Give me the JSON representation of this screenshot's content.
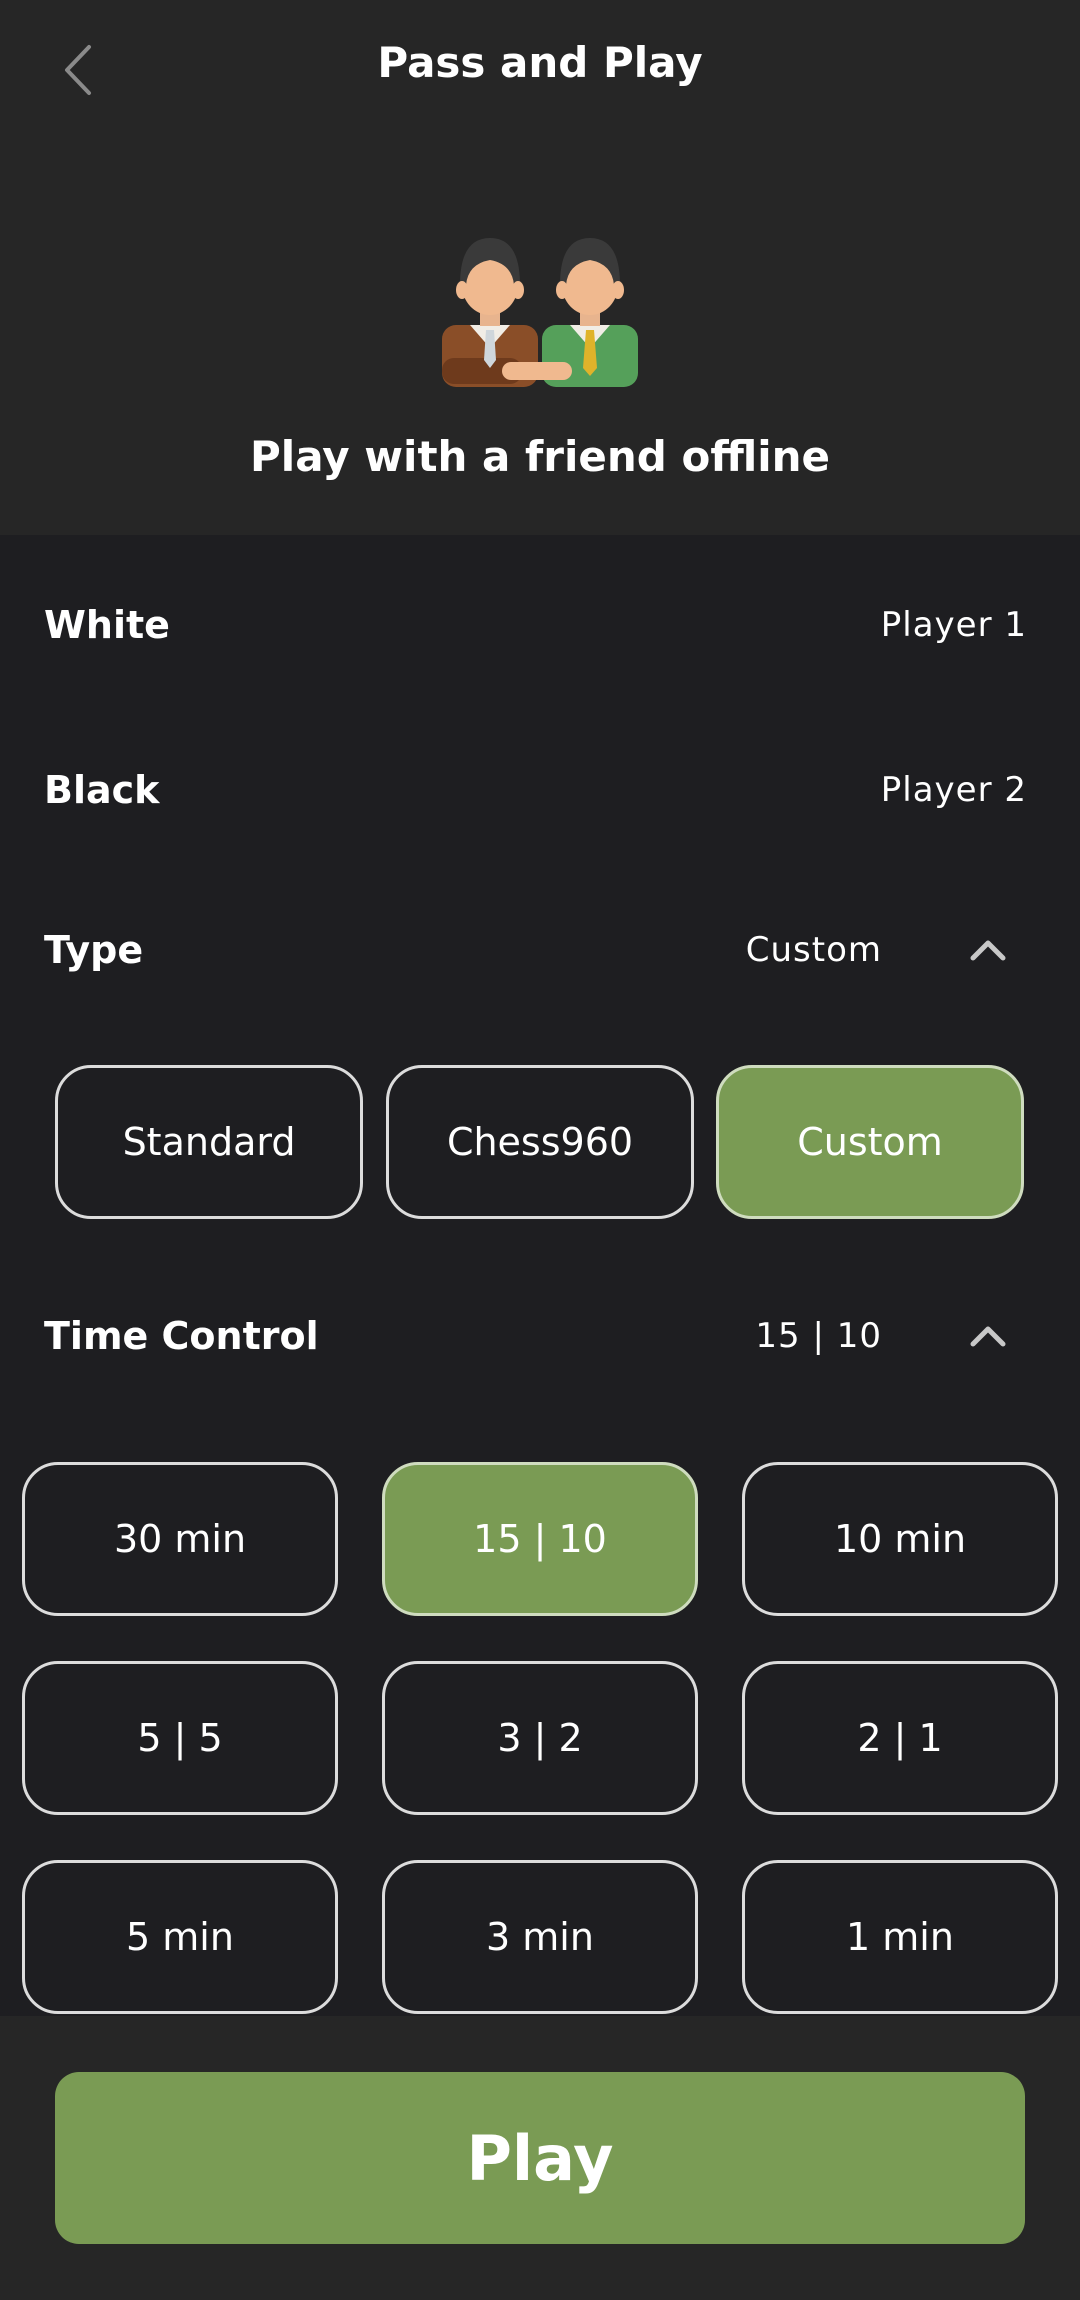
{
  "header": {
    "title": "Pass and Play",
    "back_icon": "chevron-left-icon",
    "hero_icon": "two-players-icon",
    "subtitle": "Play with a friend offline"
  },
  "players": {
    "white_label": "White",
    "white_value": "Player 1",
    "black_label": "Black",
    "black_value": "Player 2"
  },
  "type": {
    "label": "Type",
    "value": "Custom",
    "chevron_icon": "chevron-up-icon",
    "options": [
      "Standard",
      "Chess960",
      "Custom"
    ],
    "selected": "Custom"
  },
  "time_control": {
    "label": "Time Control",
    "value": "15 | 10",
    "chevron_icon": "chevron-up-icon",
    "options": [
      "30 min",
      "15 | 10",
      "10 min",
      "5 | 5",
      "3 | 2",
      "2 | 1",
      "5 min",
      "3 min",
      "1 min"
    ],
    "selected": "15 | 10"
  },
  "play_button": {
    "label": "Play"
  },
  "colors": {
    "accent": "#7a9b54",
    "background": "#1e1e21",
    "header_background": "#262626"
  }
}
